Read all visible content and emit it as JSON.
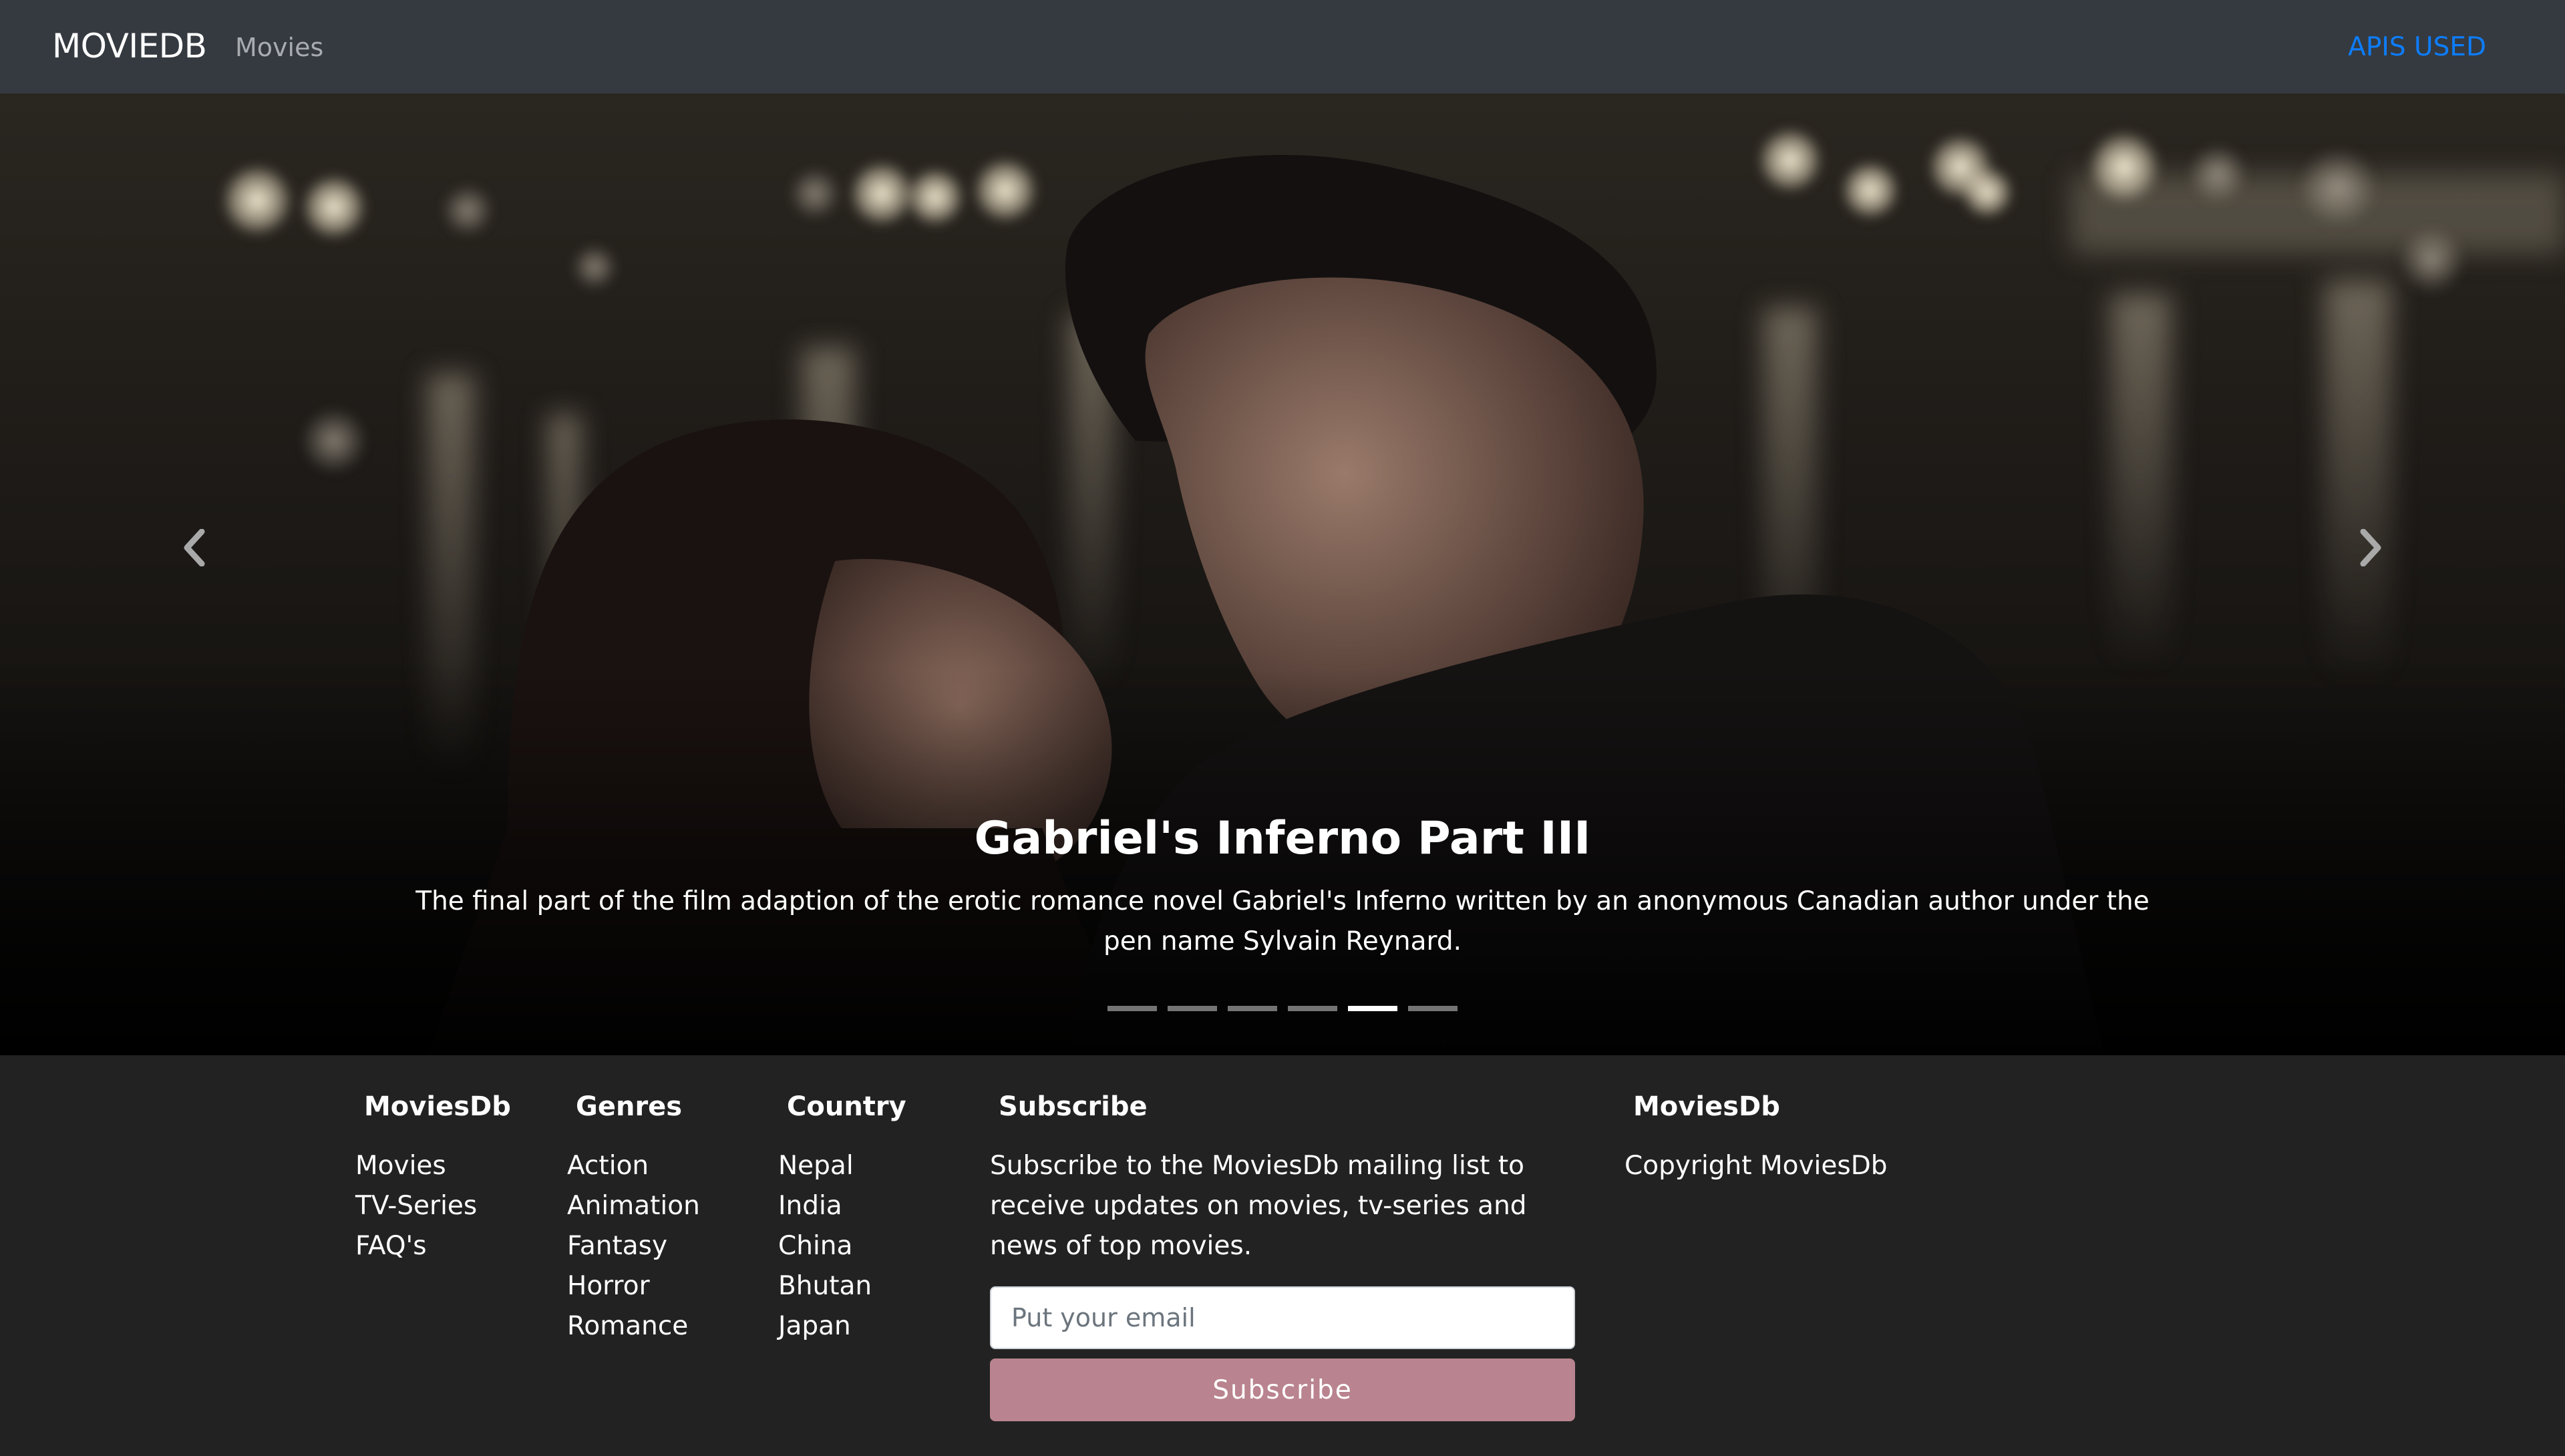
{
  "navbar": {
    "brand": "MOVIEDB",
    "movies_link": "Movies",
    "apis_link": "APIS USED"
  },
  "carousel": {
    "title": "Gabriel's Inferno Part III",
    "description": "The final part of the film adaption of the erotic romance novel Gabriel's Inferno written by an anonymous Canadian author under the pen name Sylvain Reynard.",
    "slide_count": 6,
    "active_slide": 5,
    "prev_icon": "chevron-left-icon",
    "next_icon": "chevron-right-icon"
  },
  "footer": {
    "col1": {
      "heading": "MoviesDb",
      "items": [
        "Movies",
        "TV-Series",
        "FAQ's"
      ]
    },
    "col2": {
      "heading": "Genres",
      "items": [
        "Action",
        "Animation",
        "Fantasy",
        "Horror",
        "Romance"
      ]
    },
    "col3": {
      "heading": "Country",
      "items": [
        "Nepal",
        "India",
        "China",
        "Bhutan",
        "Japan"
      ]
    },
    "subscribe": {
      "heading": "Subscribe",
      "text": "Subscribe to the MoviesDb mailing list to receive updates on movies, tv-series and news of top movies.",
      "email_placeholder": "Put your email",
      "button_label": "Subscribe"
    },
    "col5": {
      "heading": "MoviesDb",
      "copyright": "Copyright MoviesDb"
    }
  },
  "colors": {
    "navbar_bg": "#343a40",
    "footer_bg": "#222222",
    "accent_link": "#0d7dff",
    "subscribe_button": "#b9848f"
  }
}
